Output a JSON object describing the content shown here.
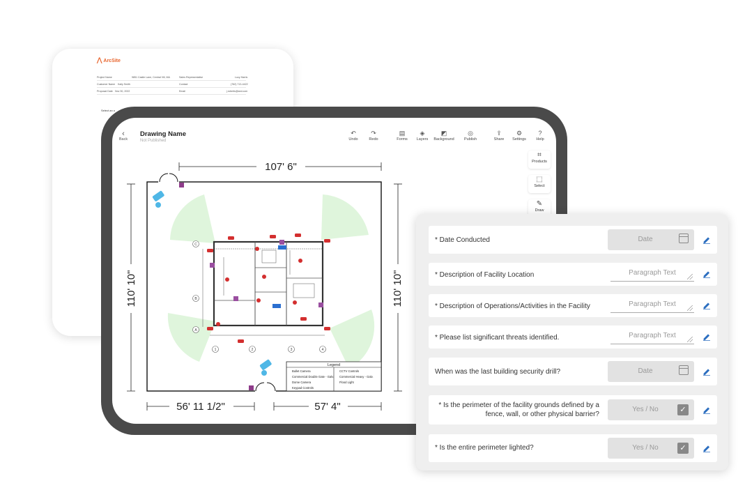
{
  "proposal": {
    "brand": "ArcSite",
    "rows": [
      {
        "label": "Project Name",
        "value": "9851 Castle Lane, Central Vill, MA",
        "label2": "Sales Representative",
        "value2": "Lucy Harris"
      },
      {
        "label": "Customer Name",
        "value": "Kaily Smith",
        "label2": "Contact",
        "value2": "(762) 713-4422"
      },
      {
        "label": "Proposal Date",
        "value": "Nov 30, 2022",
        "label2": "Email",
        "value2": "j.roberts@arcl.com"
      }
    ],
    "select_text": "Select an o"
  },
  "app": {
    "back_label": "Back",
    "drawing_name": "Drawing Name",
    "drawing_status": "Not Published",
    "toolbar": [
      {
        "label": "Undo",
        "icon": "undo-icon"
      },
      {
        "label": "Redo",
        "icon": "redo-icon"
      },
      {
        "label": "Forms",
        "icon": "forms-icon"
      },
      {
        "label": "Layers",
        "icon": "layers-icon"
      },
      {
        "label": "Background",
        "icon": "background-icon"
      },
      {
        "label": "Publish",
        "icon": "publish-icon"
      },
      {
        "label": "Share",
        "icon": "share-icon"
      },
      {
        "label": "Settings",
        "icon": "gear-icon"
      },
      {
        "label": "Help",
        "icon": "help-icon"
      }
    ],
    "side_tools": [
      {
        "label": "Products",
        "icon": "tag-icon"
      },
      {
        "label": "Select",
        "icon": "select-icon"
      },
      {
        "label": "Draw",
        "icon": "pen-icon"
      }
    ]
  },
  "plan": {
    "dim_top": "107' 6\"",
    "dim_left": "110' 10\"",
    "dim_right": "110' 10\"",
    "dim_bottom_left": "56' 11 1/2\"",
    "dim_bottom_right": "57' 4\"",
    "legend": {
      "title": "Legend",
      "items": [
        "Bullet Camera",
        "Commercial Double Gate - Galv.",
        "Dome Camera",
        "Keypad Controls",
        "CCTV Controls",
        "Commercial Heavy - Galv.",
        "Flood Light"
      ]
    },
    "grid_rows": [
      "C",
      "B",
      "A"
    ],
    "grid_cols": [
      "1",
      "2",
      "3",
      "4"
    ],
    "accent": "#d32f2f",
    "coverage_color": "#dff5dc"
  },
  "form": {
    "fields": [
      {
        "label": "* Date Conducted",
        "type": "date",
        "placeholder": "Date"
      },
      {
        "label": "* Description of Facility Location",
        "type": "paragraph",
        "placeholder": "Paragraph Text"
      },
      {
        "label": "* Description of Operations/Activities in the Facility",
        "type": "paragraph",
        "placeholder": "Paragraph Text"
      },
      {
        "label": "* Please list significant threats identified.",
        "type": "paragraph",
        "placeholder": "Paragraph Text"
      },
      {
        "label": "When was the last building security drill?",
        "type": "date",
        "placeholder": "Date"
      },
      {
        "label_line1": "* Is the perimeter of the facility grounds defined by a",
        "label_line2": "fence, wall, or other physical barrier?",
        "type": "yesno",
        "placeholder": "Yes / No"
      },
      {
        "label": "* Is the entire perimeter lighted?",
        "type": "yesno",
        "placeholder": "Yes / No"
      }
    ],
    "edit_color": "#2d6fc0"
  }
}
